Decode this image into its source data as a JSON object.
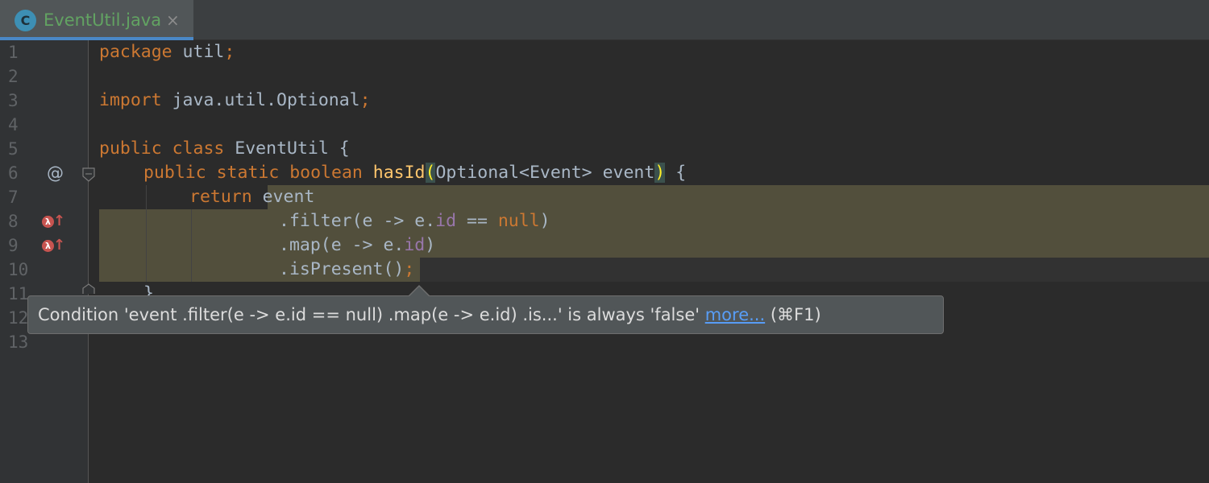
{
  "tab": {
    "icon_letter": "C",
    "title": "EventUtil.java",
    "close_glyph": "×"
  },
  "line_numbers": [
    "1",
    "2",
    "3",
    "4",
    "5",
    "6",
    "7",
    "8",
    "9",
    "10",
    "11",
    "12",
    "13"
  ],
  "code": {
    "l1_kw": "package",
    "l1_rest": " util",
    "l1_semi": ";",
    "l3_kw": "import",
    "l3_rest": " java.util.Optional",
    "l3_semi": ";",
    "l5_kw": "public class",
    "l5_rest": " EventUtil {",
    "l6_kw": "public static boolean",
    "l6_fn": "hasId",
    "l6_open": "(",
    "l6_params": "Optional<Event> event",
    "l6_close": ")",
    "l6_rest": " {",
    "l7_kw": "return",
    "l7_rest": " event",
    "l8_a": ".filter(e -> e.",
    "l8_fld": "id",
    "l8_b": " == ",
    "l8_kw": "null",
    "l8_c": ")",
    "l9_a": ".map(e -> e.",
    "l9_fld": "id",
    "l9_c": ")",
    "l10_a": ".isPresent()",
    "l10_semi": ";",
    "l11": "}"
  },
  "gutter_icons": {
    "override": "@",
    "lambda": "λ",
    "arrow": "↑"
  },
  "tooltip": {
    "text": "Condition 'event .filter(e -> e.id == null) .map(e -> e.id) .is...' is always 'false' ",
    "more": "more...",
    "shortcut": " (⌘F1)"
  },
  "colors": {
    "background": "#2b2b2b",
    "keyword": "#cc7832",
    "function": "#ffc66d",
    "field": "#9876aa",
    "text": "#a9b7c6",
    "warning_highlight": "#524f3c",
    "tab_title": "#62a362"
  }
}
